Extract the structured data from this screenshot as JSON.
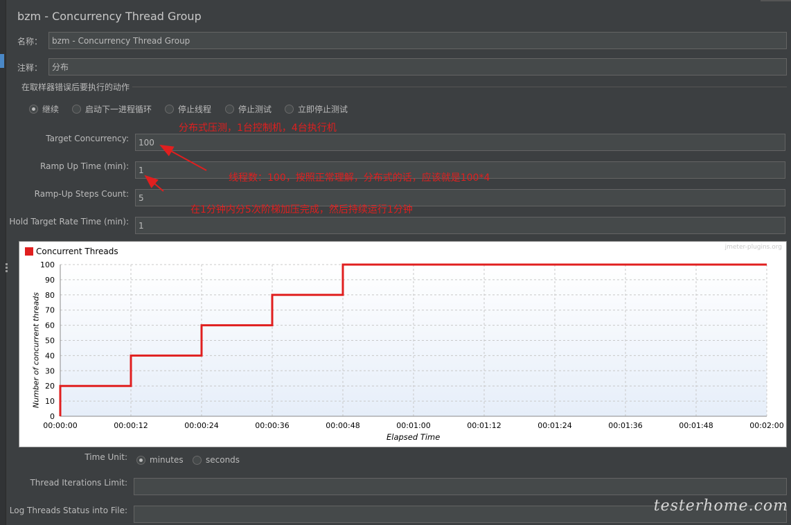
{
  "title": "bzm - Concurrency Thread Group",
  "fields": {
    "name_label": "名称：",
    "name_value": "bzm - Concurrency Thread Group",
    "comment_label": "注释：",
    "comment_value": "分布"
  },
  "error_action": {
    "title": "在取样器错误后要执行的动作",
    "options": [
      "继续",
      "启动下一进程循环",
      "停止线程",
      "停止测试",
      "立即停止测试"
    ],
    "selected": "继续"
  },
  "params": {
    "target_concurrency_label": "Target Concurrency:",
    "target_concurrency_value": "100",
    "ramp_up_time_label": "Ramp Up Time (min):",
    "ramp_up_time_value": "1",
    "ramp_up_steps_label": "Ramp-Up Steps Count:",
    "ramp_up_steps_value": "5",
    "hold_time_label": "Hold Target Rate Time (min):",
    "hold_time_value": "1"
  },
  "annotations": {
    "line1": "分布式压测，1台控制机，4台执行机",
    "line2": "线程数：100，按照正常理解，分布式的话，应该就是100*4",
    "line3": "在1分钟内分5次阶梯加压完成，然后持续运行1分钟"
  },
  "chart_watermark": "jmeter-plugins.org",
  "chart_data": {
    "type": "line",
    "title": "",
    "xlabel": "Elapsed Time",
    "ylabel": "Number of concurrent threads",
    "ylim": [
      0,
      100
    ],
    "xlim_seconds": [
      0,
      120
    ],
    "yticks": [
      "0",
      "10",
      "20",
      "30",
      "40",
      "50",
      "60",
      "70",
      "80",
      "90",
      "100"
    ],
    "xticks": [
      "00:00:00",
      "00:00:12",
      "00:00:24",
      "00:00:36",
      "00:00:48",
      "00:01:00",
      "00:01:12",
      "00:01:24",
      "00:01:36",
      "00:01:48",
      "00:02:00"
    ],
    "legend_position": "top-left",
    "grid": true,
    "series": [
      {
        "name": "Concurrent Threads",
        "color": "#e01f1f",
        "step": true,
        "points": [
          [
            0,
            0
          ],
          [
            0,
            20
          ],
          [
            12,
            20
          ],
          [
            12,
            40
          ],
          [
            24,
            40
          ],
          [
            24,
            60
          ],
          [
            36,
            60
          ],
          [
            36,
            80
          ],
          [
            48,
            80
          ],
          [
            48,
            100
          ],
          [
            120,
            100
          ]
        ]
      }
    ]
  },
  "time_unit": {
    "label": "Time Unit:",
    "options": [
      "minutes",
      "seconds"
    ],
    "selected": "minutes"
  },
  "iterations": {
    "label": "Thread Iterations Limit:",
    "value": ""
  },
  "log_threads": {
    "label": "Log Threads Status into File:",
    "value": ""
  },
  "site_watermark": "testerhome.com"
}
